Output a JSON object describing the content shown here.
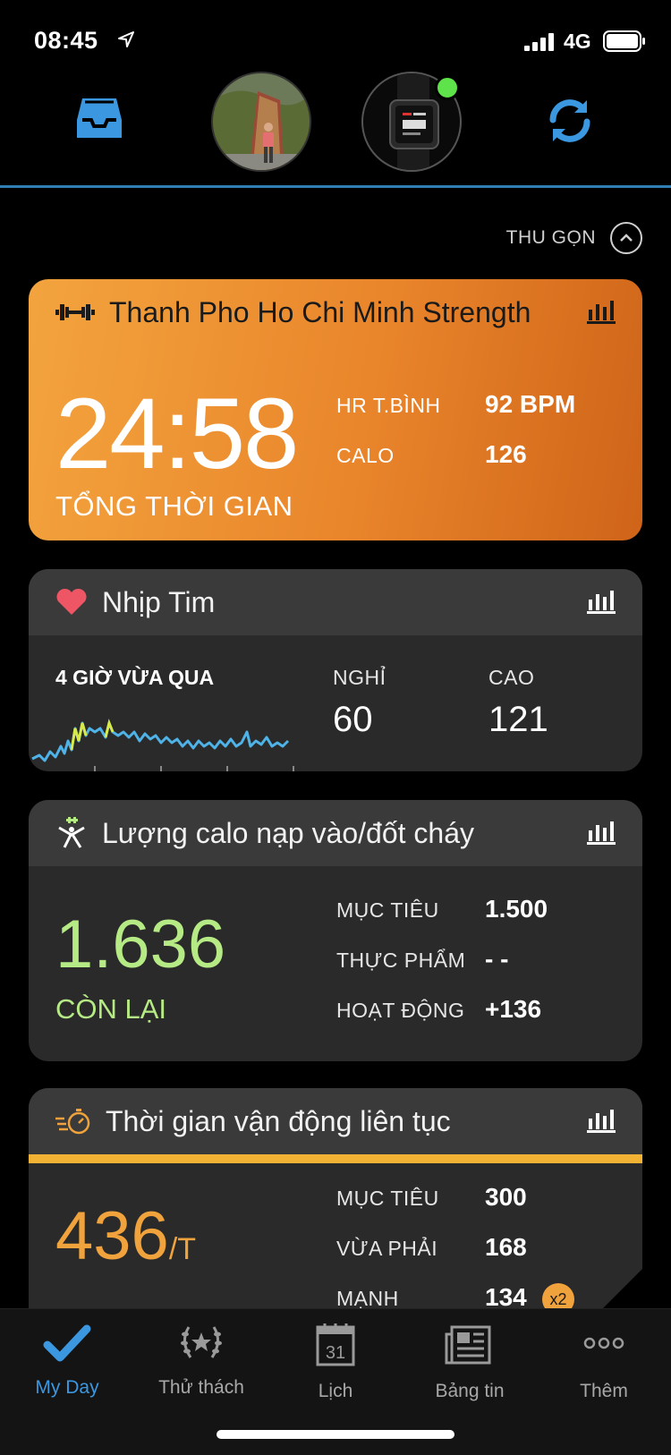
{
  "status_bar": {
    "time": "08:45",
    "network": "4G"
  },
  "header": {
    "collapse_label": "THU GỌN"
  },
  "strength_card": {
    "title": "Thanh Pho Ho Chi Minh Strength",
    "total_time": "24:58",
    "total_time_label": "TỔNG THỜI GIAN",
    "avg_hr_label": "HR T.BÌNH",
    "avg_hr_value": "92 BPM",
    "calories_label": "CALO",
    "calories_value": "126"
  },
  "heart_card": {
    "title": "Nhịp Tim",
    "range_label": "4 GIỜ VỪA QUA",
    "rest_label": "NGHỈ",
    "rest_value": "60",
    "high_label": "CAO",
    "high_value": "121"
  },
  "calorie_card": {
    "title": "Lượng calo nạp vào/đốt cháy",
    "remaining_value": "1.636",
    "remaining_label": "CÒN LẠI",
    "goal_label": "MỤC TIÊU",
    "goal_value": "1.500",
    "food_label": "THỰC PHẨM",
    "food_value": "- -",
    "activity_label": "HOẠT ĐỘNG",
    "activity_value": "+136"
  },
  "intensity_card": {
    "title": "Thời gian vận động liên tục",
    "total_value": "436",
    "total_unit": "/T",
    "goal_label": "MỤC TIÊU",
    "goal_value": "300",
    "moderate_label": "VỪA PHẢI",
    "moderate_value": "168",
    "vigorous_label": "MẠNH",
    "vigorous_value": "134",
    "multiplier": "x2"
  },
  "tabs": [
    {
      "label": "My Day",
      "active": true
    },
    {
      "label": "Thử thách",
      "active": false
    },
    {
      "label": "Lịch",
      "active": false,
      "calendar_day": "31"
    },
    {
      "label": "Bảng tin",
      "active": false
    },
    {
      "label": "Thêm",
      "active": false
    }
  ],
  "colors": {
    "accent_blue": "#3b97e0",
    "strength_orange": "#e9852b",
    "calorie_green": "#b6ea84",
    "intensity_orange": "#f0a23c",
    "device_online": "#5fe34a",
    "heart_red": "#ee5565"
  }
}
